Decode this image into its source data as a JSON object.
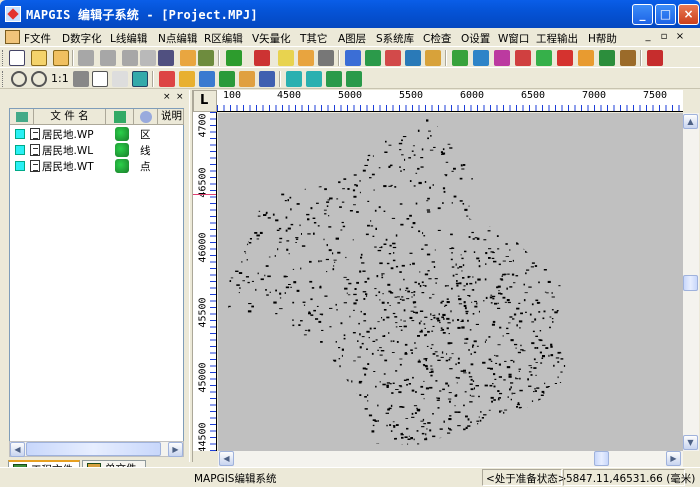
{
  "window": {
    "title": "MAPGIS 编辑子系统 - [Project.MPJ]",
    "controls": {
      "minimize": "_",
      "maximize": "□",
      "close": "×"
    }
  },
  "menu": {
    "items": [
      "F文件",
      "D数字化",
      "L线编辑",
      "N点编辑",
      "R区编辑",
      "V矢量化",
      "T其它",
      "A图层",
      "S系统库",
      "C检查",
      "O设置",
      "W窗口",
      "工程输出",
      "H帮助"
    ],
    "mdi_controls": [
      "_",
      "▫",
      "×"
    ]
  },
  "toolbar2": {
    "zoom_ratio": "1:1"
  },
  "left_panel": {
    "close_buttons": [
      "×",
      "×"
    ],
    "columns": {
      "name": "文 件 名",
      "type": "说明"
    },
    "files": [
      {
        "name": "居民地.WP",
        "type": "区"
      },
      {
        "name": "居民地.WL",
        "type": "线"
      },
      {
        "name": "居民地.WT",
        "type": "点"
      }
    ],
    "scroll_left": "◀",
    "scroll_right": "▶",
    "tabs": [
      {
        "label": "工程文件",
        "active": true
      },
      {
        "label": "单文件",
        "active": false
      }
    ]
  },
  "map": {
    "corner_label": "L",
    "x_ruler": [
      "100",
      "4500",
      "5000",
      "5500",
      "6000",
      "6500",
      "7000",
      "7500"
    ],
    "y_ruler": [
      "4700",
      "46500",
      "46000",
      "45500",
      "45000",
      "44500"
    ],
    "canvas_color": "#c0c0c0",
    "feature_color": "#000000",
    "scroll_up": "▲",
    "scroll_down": "▼",
    "scroll_left": "◀",
    "scroll_right": "▶"
  },
  "status": {
    "app_name": "MAPGIS编辑系统",
    "state": "<处于准备状态>",
    "coords": "5847.11,46531.66 (毫米)"
  }
}
